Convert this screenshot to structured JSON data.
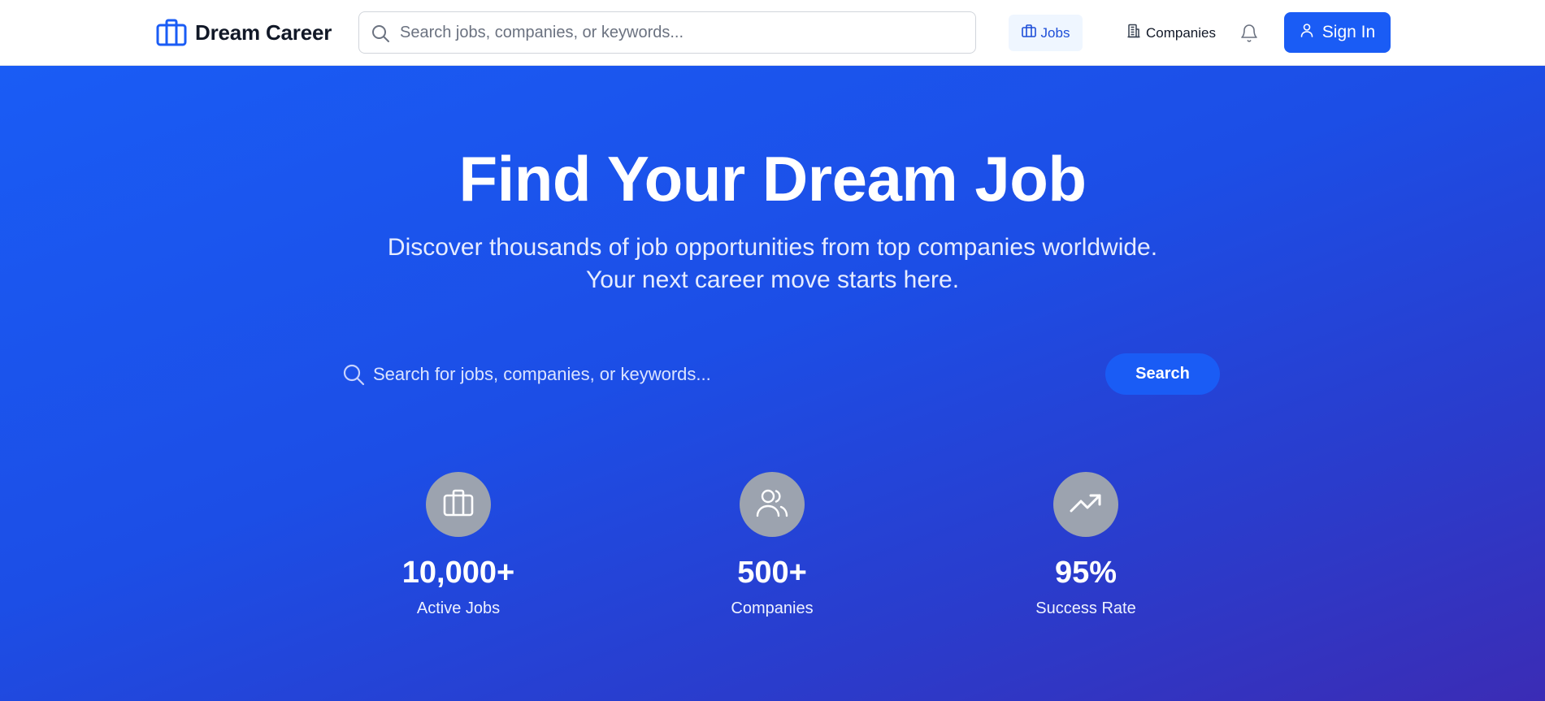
{
  "header": {
    "brand_name": "Dream Career",
    "search_placeholder": "Search jobs, companies, or keywords...",
    "nav": {
      "jobs_label": "Jobs",
      "companies_label": "Companies",
      "sign_in_label": "Sign In"
    },
    "icons": {
      "brand": "briefcase-icon",
      "search": "search-icon",
      "jobs": "briefcase-icon",
      "companies": "building-icon",
      "notifications": "bell-icon",
      "sign_in": "user-icon"
    }
  },
  "hero": {
    "title": "Find Your Dream Job",
    "subtitle_line1": "Discover thousands of job opportunities from top companies worldwide.",
    "subtitle_line2": "Your next career move starts here.",
    "search": {
      "placeholder": "Search for jobs, companies, or keywords...",
      "button_label": "Search"
    },
    "stats": [
      {
        "icon": "briefcase-icon",
        "value": "10,000+",
        "label": "Active Jobs"
      },
      {
        "icon": "users-icon",
        "value": "500+",
        "label": "Companies"
      },
      {
        "icon": "trending-up-icon",
        "value": "95%",
        "label": "Success Rate"
      }
    ]
  },
  "colors": {
    "primary": "#1a5cf5",
    "hero_gradient_start": "#1a5cf5",
    "hero_gradient_end": "#3b2cb5",
    "active_nav_bg": "#eff6ff",
    "active_nav_text": "#1d4ed8",
    "stat_circle": "#9ca3af"
  }
}
